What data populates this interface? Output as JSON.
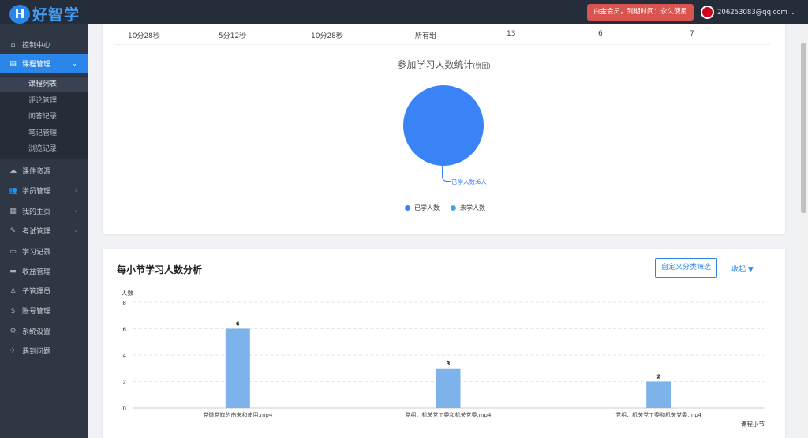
{
  "header": {
    "logo_letter": "H",
    "logo_text": "好智学",
    "vip_badge": "白金会员，到期时间：永久使用",
    "user_email": "206253083@qq.com",
    "user_caret": "⌄"
  },
  "sidebar": {
    "items": [
      {
        "label": "控制中心",
        "icon": "home-icon",
        "glyph": "⌂",
        "arrow": ""
      },
      {
        "label": "课程管理",
        "icon": "book-icon",
        "glyph": "▤",
        "arrow": "⌄"
      },
      {
        "label": "课件资源",
        "icon": "cloud-icon",
        "glyph": "☁",
        "arrow": ""
      },
      {
        "label": "学员管理",
        "icon": "users-icon",
        "glyph": "👥",
        "arrow": "‹"
      },
      {
        "label": "我的主页",
        "icon": "grid-icon",
        "glyph": "▦",
        "arrow": "‹"
      },
      {
        "label": "考试管理",
        "icon": "tag-icon",
        "glyph": "✎",
        "arrow": "‹"
      },
      {
        "label": "学习记录",
        "icon": "notebook-icon",
        "glyph": "▭",
        "arrow": ""
      },
      {
        "label": "收益管理",
        "icon": "card-icon",
        "glyph": "▬",
        "arrow": ""
      },
      {
        "label": "子管理员",
        "icon": "admin-icon",
        "glyph": "♙",
        "arrow": ""
      },
      {
        "label": "账号管理",
        "icon": "dollar-icon",
        "glyph": "$",
        "arrow": ""
      },
      {
        "label": "系统设置",
        "icon": "gear-icon",
        "glyph": "⚙",
        "arrow": ""
      },
      {
        "label": "遇到问题",
        "icon": "tool-icon",
        "glyph": "✈",
        "arrow": ""
      }
    ],
    "submenu": [
      "课程列表",
      "评论管理",
      "问答记录",
      "笔记管理",
      "浏览记录"
    ],
    "current_sub": "课程列表"
  },
  "table_row": [
    "10分28秒",
    "5分12秒",
    "10分28秒",
    "所有组",
    "13",
    "6",
    "7"
  ],
  "pie": {
    "title": "参加学习人数统计",
    "title_suffix": "(饼图)",
    "slice_label": "已学人数:6人",
    "legend": [
      {
        "name": "已学人数",
        "color": "#3a83f6"
      },
      {
        "name": "未学人数",
        "color": "#3fa7e6"
      }
    ]
  },
  "section": {
    "title": "每小节学习人数分析",
    "filter_button": "自定义分类筛选",
    "collapse": "收起 ▼"
  },
  "chart_data": [
    {
      "type": "pie",
      "title": "参加学习人数统计(饼图)",
      "slices": [
        {
          "name": "已学人数",
          "value": 6
        },
        {
          "name": "未学人数",
          "value": 0
        }
      ],
      "colors": [
        "#3a83f6",
        "#3fa7e6"
      ]
    },
    {
      "type": "bar",
      "categories": [
        "党徽党旗的由来和使用.mp4",
        "党组、机关党工委和机关党委.mp4",
        "党组、机关党工委和机关党委.mp4"
      ],
      "values": [
        6,
        3,
        2
      ],
      "ylabel": "人数",
      "xlabel": "课程小节",
      "ylim": [
        0,
        8
      ],
      "yticks": [
        0,
        2,
        4,
        6,
        8
      ],
      "grid": true,
      "bar_color": "#7db3ea"
    }
  ]
}
